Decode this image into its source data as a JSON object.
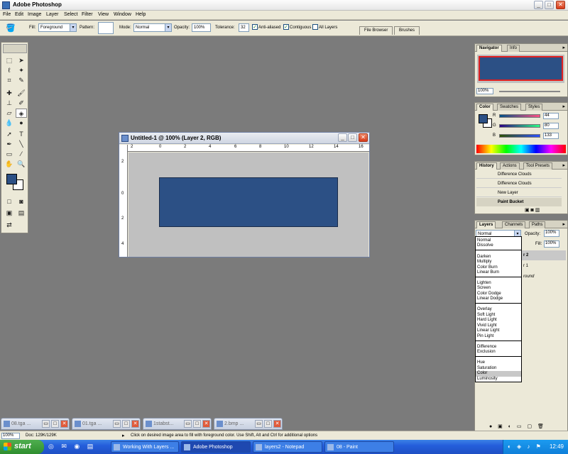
{
  "app": {
    "title": "Adobe Photoshop"
  },
  "menu": [
    "File",
    "Edit",
    "Image",
    "Layer",
    "Select",
    "Filter",
    "View",
    "Window",
    "Help"
  ],
  "options": {
    "fill_label": "Fill:",
    "fill_value": "Foreground",
    "pattern_label": "Pattern:",
    "mode_label": "Mode:",
    "mode_value": "Normal",
    "opacity_label": "Opacity:",
    "opacity_value": "100%",
    "tolerance_label": "Tolerance:",
    "tolerance_value": "32",
    "anti_aliased": "Anti-aliased",
    "contiguous": "Contiguous",
    "all_layers": "All Layers",
    "well_tabs": [
      "File Browser",
      "Brushes"
    ]
  },
  "document": {
    "title": "Untitled-1 @ 100% (Layer 2, RGB)",
    "ruler_top": [
      "2",
      "0",
      "2",
      "4",
      "6",
      "8",
      "10",
      "12",
      "14",
      "16"
    ],
    "ruler_left": [
      "2",
      "0",
      "2",
      "4"
    ],
    "fill_color": "#2c5085"
  },
  "navigator": {
    "tabs": [
      "Navigator",
      "Info"
    ],
    "zoom": "100%"
  },
  "color": {
    "tabs": [
      "Color",
      "Swatches",
      "Styles"
    ],
    "r_label": "R",
    "g_label": "G",
    "b_label": "B",
    "r": "44",
    "g": "80",
    "b": "133"
  },
  "history": {
    "tabs": [
      "History",
      "Actions",
      "Tool Presets"
    ],
    "items": [
      "Difference Clouds",
      "Difference Clouds",
      "New Layer",
      "Paint Bucket"
    ]
  },
  "layers": {
    "tabs": [
      "Layers",
      "Channels",
      "Paths"
    ],
    "blend_mode": "Normal",
    "opacity_label": "Opacity:",
    "opacity_value": "100%",
    "fill_label": "Fill:",
    "fill_value": "100%",
    "rows": [
      "r 2",
      "r 1",
      "round"
    ]
  },
  "blend_groups": [
    [
      "Normal",
      "Dissolve"
    ],
    [
      "Darken",
      "Multiply",
      "Color Burn",
      "Linear Burn"
    ],
    [
      "Lighten",
      "Screen",
      "Color Dodge",
      "Linear Dodge"
    ],
    [
      "Overlay",
      "Soft Light",
      "Hard Light",
      "Vivid Light",
      "Linear Light",
      "Pin Light"
    ],
    [
      "Difference",
      "Exclusion"
    ],
    [
      "Hue",
      "Saturation",
      "Color",
      "Luminosity"
    ]
  ],
  "blend_selected": "Color",
  "minimized_docs": [
    "08.tga ...",
    "01.tga ...",
    "1stabst...",
    "2.bmp ..."
  ],
  "status": {
    "zoom": "100%",
    "doc": "Doc: 129K/129K",
    "hint": "Click on desired image area to fill with foreground color. Use Shift, Alt and Ctrl for additional options"
  },
  "taskbar": {
    "start": "start",
    "tasks": [
      "Working With Layers ...",
      "Adobe Photoshop",
      "layers2 - Notepad",
      "08 - Paint"
    ],
    "active_task": "Adobe Photoshop",
    "clock": "12:49"
  }
}
